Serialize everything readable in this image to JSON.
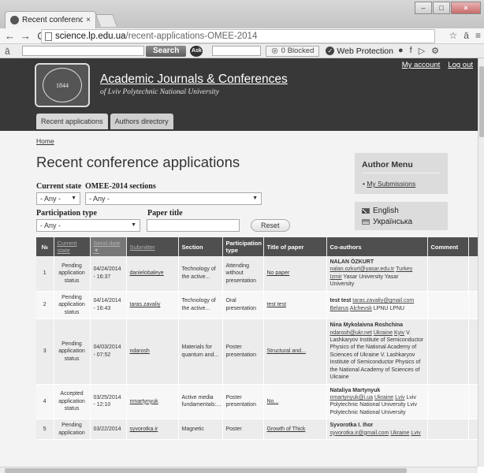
{
  "browser": {
    "tab_title": "Recent conference applic",
    "tab_close": "×",
    "url_host": "science.lp.edu.ua",
    "url_path": "/recent-applications-OMEE-2014",
    "back": "←",
    "forward": "→",
    "reload": "C",
    "star": "☆",
    "menu": "≡",
    "ext": "ā",
    "win_min": "–",
    "win_max": "□",
    "win_close": "×"
  },
  "toolbar": {
    "logo": "ā",
    "search_button": "Search",
    "ask": "Ask",
    "blocked_label": "0 Blocked",
    "web_protection": "Web Protection"
  },
  "site": {
    "name": "Academic Journals & Conferences",
    "slogan": "of Lviv Polytechnic National University",
    "my_account": "My account",
    "log_out": "Log out",
    "tabs": [
      "Recent applications",
      "Authors directory"
    ],
    "seal_text": "1844"
  },
  "page": {
    "breadcrumb": "Home",
    "title": "Recent conference applications"
  },
  "filters": {
    "current_state_label": "Current state",
    "current_state_value": "- Any -",
    "sections_label": "OMEE-2014 sections",
    "sections_value": "- Any -",
    "participation_label": "Participation type",
    "participation_value": "- Any -",
    "paper_title_label": "Paper title",
    "paper_title_value": "",
    "reset_label": "Reset"
  },
  "sidebar": {
    "author_menu_title": "Author Menu",
    "my_submissions": "My Submissions",
    "languages": [
      "English",
      "Українська"
    ]
  },
  "table": {
    "headers": [
      "№",
      "Current state",
      "Send date",
      "Submitter",
      "Section",
      "Participation type",
      "Title of paper",
      "Co-authors",
      "Comment"
    ],
    "rows": [
      {
        "num": "1",
        "state": "Pending application status",
        "date": "04/24/2014 - 16:37",
        "submitter": "danielobaleye",
        "section": "Technology of the active...",
        "ptype": "Attending without presentation",
        "title": "No paper",
        "co_name": "NALAN ÖZKURT",
        "co_email": "nalan.ozkurt@yasar.edu.tr",
        "co_country": "Turkey",
        "co_city": "Izmir",
        "co_affil": "Yasar University Yasar University",
        "comment": ""
      },
      {
        "num": "2",
        "state": "Pending application status",
        "date": "04/14/2014 - 16:43",
        "submitter": "taras.zavaliy",
        "section": "Technology of the active...",
        "ptype": "Oral presentation",
        "title": "test test",
        "co_name": "test test",
        "co_email": "taras.zavaliy@gmail.com",
        "co_country": "Belarus",
        "co_city": "Alchevsk",
        "co_affil": "LPNU LPNU",
        "comment": ""
      },
      {
        "num": "3",
        "state": "Pending application status",
        "date": "04/03/2014 - 07:52",
        "submitter": "ndarosh",
        "section": "Materials for quantum and...",
        "ptype": "Poster presentation",
        "title": "Structural and...",
        "co_name": "Nina Mykolaivna Roshchina",
        "co_email": "ndarosh@ukr.net",
        "co_country": "Ukraine",
        "co_city": "Kyiv",
        "co_affil": "V. Lashkaryov Institute of Semiconductor Physics of the National Academy of Sciences of Ukraine V. Lashkaryov Institute of Semiconductor Physics of the National Academy of Sciences of Ukraine",
        "comment": ""
      },
      {
        "num": "4",
        "state": "Accepted application status",
        "date": "03/25/2014 - 12:10",
        "submitter": "nmartynyuk",
        "section": "Active media fundamentals:...",
        "ptype": "Poster presentation",
        "title": "No...",
        "co_name": "Nataliya Martynyuk",
        "co_email": "nmartynyuk@i.ua",
        "co_country": "Ukraine",
        "co_city": "Lviv",
        "co_affil": "Lviv Polytechnic National University Lviv Polytechnic National University",
        "comment": ""
      },
      {
        "num": "5",
        "state": "Pending application",
        "date": "03/22/2014",
        "submitter": "syvorotka.ir",
        "section": "Magnetic",
        "ptype": "Poster",
        "title": "Growth of Thick",
        "co_name": "Syvorotka I. Ihor",
        "co_email": "syvorotka.ir@gmail.com",
        "co_country": "Ukraine",
        "co_city": "Lviv",
        "co_affil": "",
        "comment": ""
      }
    ]
  }
}
